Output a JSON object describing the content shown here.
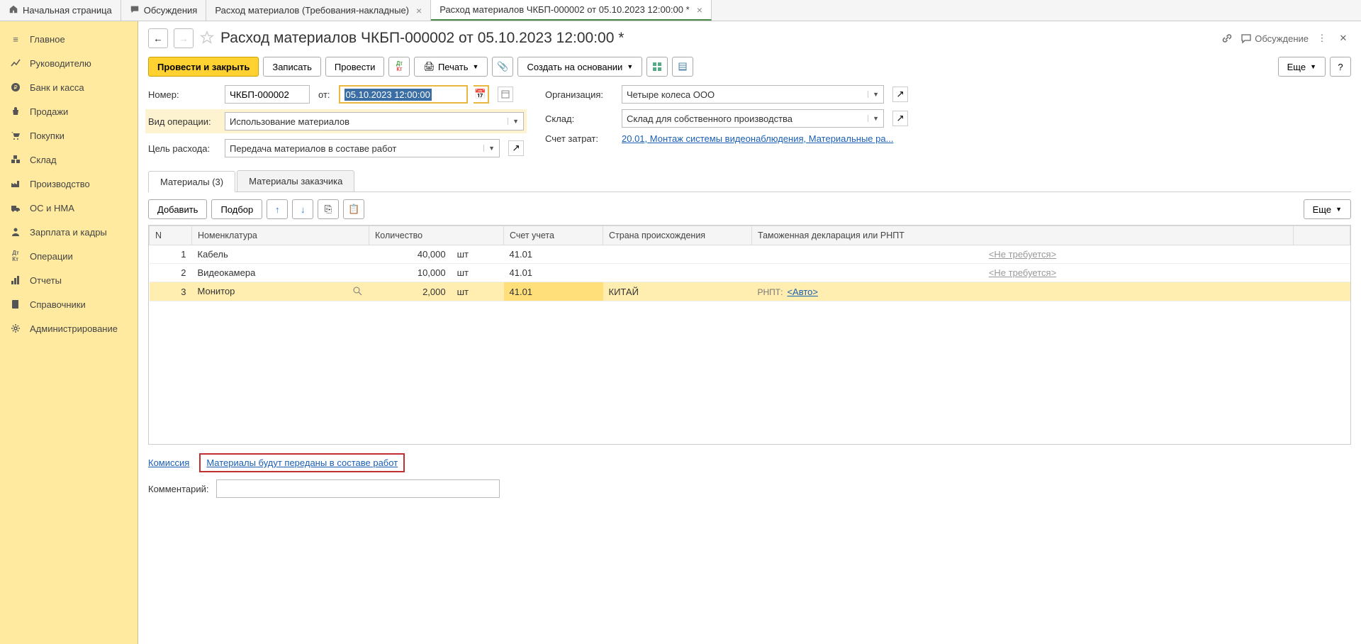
{
  "topTabs": [
    {
      "label": "Начальная страница",
      "icon": "home"
    },
    {
      "label": "Обсуждения",
      "icon": "chat"
    },
    {
      "label": "Расход материалов (Требования-накладные)",
      "closable": true
    },
    {
      "label": "Расход материалов ЧКБП-000002 от 05.10.2023 12:00:00 *",
      "closable": true,
      "active": true
    }
  ],
  "sidebar": [
    {
      "label": "Главное",
      "icon": "menu"
    },
    {
      "label": "Руководителю",
      "icon": "chart"
    },
    {
      "label": "Банк и касса",
      "icon": "ruble"
    },
    {
      "label": "Продажи",
      "icon": "bag"
    },
    {
      "label": "Покупки",
      "icon": "cart"
    },
    {
      "label": "Склад",
      "icon": "boxes"
    },
    {
      "label": "Производство",
      "icon": "factory"
    },
    {
      "label": "ОС и НМА",
      "icon": "truck"
    },
    {
      "label": "Зарплата и кадры",
      "icon": "person"
    },
    {
      "label": "Операции",
      "icon": "dtkt"
    },
    {
      "label": "Отчеты",
      "icon": "bars"
    },
    {
      "label": "Справочники",
      "icon": "book"
    },
    {
      "label": "Администрирование",
      "icon": "gear"
    }
  ],
  "title": "Расход материалов ЧКБП-000002 от 05.10.2023 12:00:00 *",
  "toolbar": {
    "post_close": "Провести и закрыть",
    "write": "Записать",
    "post": "Провести",
    "print": "Печать",
    "create_based": "Создать на основании",
    "more": "Еще",
    "discuss": "Обсуждение"
  },
  "form": {
    "number_label": "Номер:",
    "number_value": "ЧКБП-000002",
    "from_label": "от:",
    "date_value": "05.10.2023 12:00:00",
    "op_type_label": "Вид операции:",
    "op_type_value": "Использование материалов",
    "purpose_label": "Цель расхода:",
    "purpose_value": "Передача материалов в составе работ",
    "org_label": "Организация:",
    "org_value": "Четыре колеса ООО",
    "wh_label": "Склад:",
    "wh_value": "Склад для собственного производства",
    "cost_label": "Счет затрат:",
    "cost_link": "20.01, Монтаж системы видеонаблюдения, Материальные ра..."
  },
  "innerTabs": {
    "materials": "Материалы (3)",
    "customer": "Материалы заказчика"
  },
  "tblToolbar": {
    "add": "Добавить",
    "pick": "Подбор",
    "more": "Еще"
  },
  "tblHeaders": {
    "n": "N",
    "nom": "Номенклатура",
    "qty": "Количество",
    "acct": "Счет учета",
    "country": "Страна происхождения",
    "decl": "Таможенная декларация или РНПТ"
  },
  "rows": [
    {
      "n": "1",
      "nom": "Кабель",
      "qty": "40,000",
      "unit": "шт",
      "acct": "41.01",
      "country": "",
      "decl": "<Не требуется>",
      "decl_type": "none"
    },
    {
      "n": "2",
      "nom": "Видеокамера",
      "qty": "10,000",
      "unit": "шт",
      "acct": "41.01",
      "country": "",
      "decl": "<Не требуется>",
      "decl_type": "none"
    },
    {
      "n": "3",
      "nom": "Монитор",
      "qty": "2,000",
      "unit": "шт",
      "acct": "41.01",
      "country": "КИТАЙ",
      "decl_prefix": "РНПТ:",
      "decl": "<Авто>",
      "decl_type": "auto",
      "selected": true
    }
  ],
  "bottom": {
    "commission": "Комиссия",
    "transfer_note": "Материалы будут переданы в составе работ",
    "comment_label": "Комментарий:"
  }
}
